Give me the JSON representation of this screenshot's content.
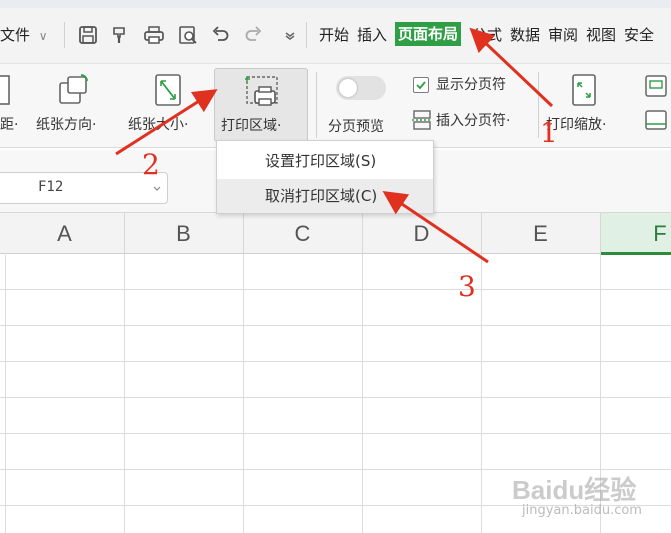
{
  "menubar": {
    "file_label": "文件",
    "tabs": [
      "开始",
      "插入",
      "页面布局",
      "公式",
      "数据",
      "审阅",
      "视图",
      "安全"
    ],
    "active_tab": "页面布局"
  },
  "ribbon": {
    "margins_label": "距·",
    "orientation_label": "纸张方向·",
    "size_label": "纸张大小·",
    "print_area_label": "打印区域·",
    "page_break_preview_label": "分页预览",
    "show_page_breaks_label": "显示分页符",
    "show_page_breaks_checked": true,
    "insert_page_break_label": "插入分页符·",
    "print_scale_label": "打印缩放·"
  },
  "formula_bar": {
    "cell_reference": "F12"
  },
  "sheet": {
    "columns": [
      "A",
      "B",
      "C",
      "D",
      "E",
      "F"
    ],
    "active_column": "F"
  },
  "dropdown": {
    "items": [
      "设置打印区域(S)",
      "取消打印区域(C)"
    ],
    "hovered_index": 1
  },
  "annotations": {
    "step_labels": [
      "1",
      "2",
      "3"
    ],
    "color": "#e03020"
  },
  "watermark": {
    "brand": "Baidu经验",
    "url": "jingyan.baidu.com"
  },
  "colors": {
    "active_tab_bg": "#2f9e44",
    "active_column_border": "#2e8b3e"
  }
}
